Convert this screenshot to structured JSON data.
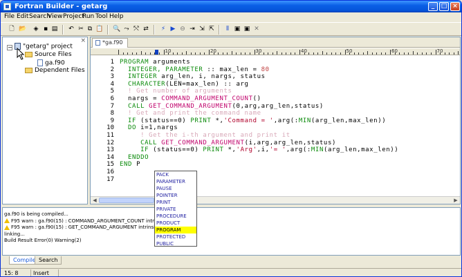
{
  "window": {
    "title": "Fortran Builder - getarg"
  },
  "menu": [
    "File",
    "Edit",
    "Search",
    "View",
    "Project",
    "Run",
    "Tool",
    "Help"
  ],
  "tree": {
    "project": "\"getarg\" project",
    "source_files": "Source Files",
    "file": "ga.f90",
    "dependent_files": "Dependent Files"
  },
  "editor": {
    "tab_label": "*ga.f90",
    "ruler_labels": [
      "10",
      "20",
      "30",
      "40",
      "50",
      "60",
      "70"
    ],
    "line_numbers": [
      "1",
      "2",
      "3",
      "4",
      "5",
      "6",
      "7",
      "8",
      "9",
      "10",
      "11",
      "12",
      "13",
      "14",
      "15",
      "16",
      "17"
    ],
    "lines": [
      [
        [
          "kw",
          "PROGRAM"
        ],
        [
          "pl",
          " arguments"
        ]
      ],
      [
        [
          "kw",
          "  INTEGER, PARAMETER"
        ],
        [
          "pl",
          " :: max_len = "
        ],
        [
          "nm",
          "80"
        ]
      ],
      [
        [
          "kw",
          "  INTEGER"
        ],
        [
          "pl",
          " arg_len, i, nargs, status"
        ]
      ],
      [
        [
          "kw",
          "  CHARACTER"
        ],
        [
          "pl",
          "(LEN=max_len) :: arg"
        ]
      ],
      [
        [
          "cm",
          "  ! Get number of arguments"
        ]
      ],
      [
        [
          "pl",
          "  nargs = "
        ],
        [
          "fn",
          "COMMAND_ARGUMENT_COUNT"
        ],
        [
          "pl",
          "()"
        ]
      ],
      [
        [
          "kw",
          "  CALL"
        ],
        [
          "pl",
          " "
        ],
        [
          "fn",
          "GET_COMMAND_ARGUMENT"
        ],
        [
          "pl",
          "(0,arg,arg_len,status)"
        ]
      ],
      [
        [
          "cm",
          "  ! Get and print the command name"
        ]
      ],
      [
        [
          "kw",
          "  IF"
        ],
        [
          "pl",
          " (status==0) "
        ],
        [
          "kw",
          "PRINT"
        ],
        [
          "pl",
          " *,"
        ],
        [
          "st",
          "'Command = '"
        ],
        [
          "pl",
          ",arg(:"
        ],
        [
          "kw",
          "MIN"
        ],
        [
          "pl",
          "(arg_len,max_len))"
        ]
      ],
      [
        [
          "kw",
          "  DO"
        ],
        [
          "pl",
          " i=1,nargs"
        ]
      ],
      [
        [
          "cm",
          "     ! Get the i-th argument and print it"
        ]
      ],
      [
        [
          "kw",
          "     CALL"
        ],
        [
          "pl",
          " "
        ],
        [
          "fn",
          "GET_COMMAND_ARGUMENT"
        ],
        [
          "pl",
          "(i,arg,arg_len,status)"
        ]
      ],
      [
        [
          "kw",
          "     IF"
        ],
        [
          "pl",
          " (status==0) "
        ],
        [
          "kw",
          "PRINT"
        ],
        [
          "pl",
          " *,"
        ],
        [
          "st",
          "'Arg'"
        ],
        [
          "pl",
          ",i,"
        ],
        [
          "st",
          "'= '"
        ],
        [
          "pl",
          ",arg(:"
        ],
        [
          "kw",
          "MIN"
        ],
        [
          "pl",
          "(arg_len,max_len))"
        ]
      ],
      [
        [
          "kw",
          "  ENDDO"
        ]
      ],
      [
        [
          "kw",
          "END"
        ],
        [
          "pl",
          " P"
        ]
      ],
      [],
      []
    ]
  },
  "autocomplete": {
    "items": [
      "PACK",
      "PARAMETER",
      "PAUSE",
      "POINTER",
      "PRINT",
      "PRIVATE",
      "PROCEDURE",
      "PRODUCT",
      "PROGRAM",
      "PROTECTED",
      "PUBLIC"
    ],
    "selected": "PROGRAM"
  },
  "output": {
    "lines": [
      {
        "warn": false,
        "text": "ga.f90 is being compiled..."
      },
      {
        "warn": true,
        "text": "F95 warn : ga.f90(15) : COMMAND_ARGUMENT_COUNT intrinsic p"
      },
      {
        "warn": true,
        "text": "F95 warn : ga.f90(15) : GET_COMMAND_ARGUMENT intrinsic proc"
      },
      {
        "warn": false,
        "text": "linking..."
      },
      {
        "warn": false,
        "text": "Build Result Error(0) Warning(2)"
      }
    ],
    "tabs": [
      "Compile",
      "Search"
    ]
  },
  "status": {
    "position": "15:  8",
    "mode": "Insert"
  },
  "colors": {
    "titlebar": "#0a5fe6",
    "highlight": "#ffff00",
    "keyword": "#0a8a0a"
  }
}
